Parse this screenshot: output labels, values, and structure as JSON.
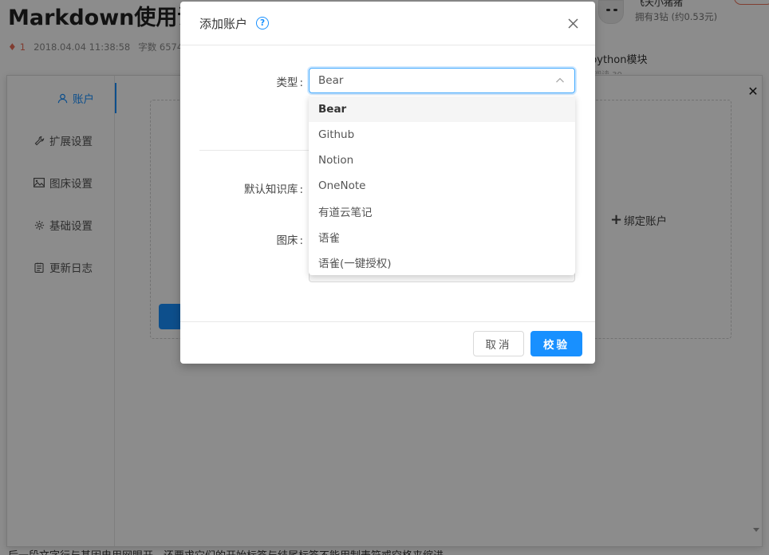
{
  "background": {
    "article_title": "Markdown使用说明",
    "meta": {
      "count": "1",
      "datetime": "2018.04.04 11:38:58",
      "word_count": "字数 6574"
    },
    "author": {
      "name": "飞天小猪猪",
      "info": "拥有3钻 (约0.53元)"
    },
    "right_link": "python模块",
    "right_link_sub": "阅读 30",
    "bottom_text": "后一段文字行与基因电用网眼开，还要求它们的开始标签与结尾标签不能用制表符或空格来缩进。"
  },
  "panel": {
    "nav": [
      {
        "label": "账户",
        "icon": "user-icon",
        "active": true
      },
      {
        "label": "扩展设置",
        "icon": "wrench-icon",
        "active": false
      },
      {
        "label": "图床设置",
        "icon": "image-icon",
        "active": false
      },
      {
        "label": "基础设置",
        "icon": "gear-icon",
        "active": false
      },
      {
        "label": "更新日志",
        "icon": "log-icon",
        "active": false
      }
    ],
    "bind_account_label": "绑定账户",
    "close_glyph": "✕"
  },
  "modal": {
    "title": "添加账户",
    "help_glyph": "?",
    "labels": {
      "type": "类型",
      "default_repo": "默认知识库",
      "image_host": "图床"
    },
    "select": {
      "value": "Bear"
    },
    "options": [
      "Bear",
      "Github",
      "Notion",
      "OneNote",
      "有道云笔记",
      "语雀",
      "语雀(一键授权)"
    ],
    "selected_index": 0,
    "cancel_label": "取消",
    "ok_label": "校验"
  },
  "colors": {
    "primary": "#1890ff",
    "overlay": "rgba(0,0,0,0.45)"
  }
}
